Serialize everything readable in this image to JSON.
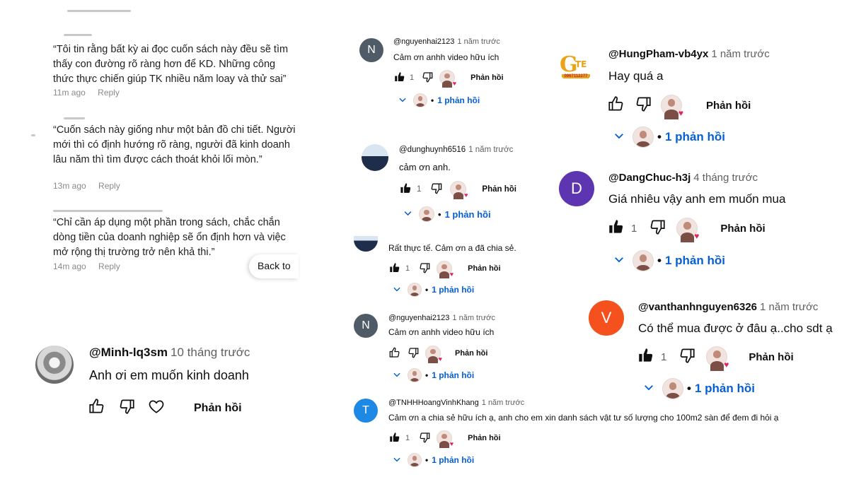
{
  "left_panel": {
    "top_fragment": "",
    "quotes": [
      {
        "text": "“Tôi tin rằng bất kỳ ai đọc cuốn sách này đều sẽ tìm thấy con đường rõ ràng hơn để KD. Những công thức thực chiến giúp TK nhiều năm loay và thử sai”",
        "time": "11m ago",
        "reply": "Reply"
      },
      {
        "text": "“Cuốn sách này giống như một bản đồ chi tiết. Người mới thì có định hướng rõ ràng, người đã kinh doanh lâu năm thì tìm được cách thoát khỏi lối mòn.”",
        "time": "13m ago",
        "reply": "Reply"
      },
      {
        "text": "“Chỉ cần áp dụng một phần trong sách, chắc chắn dòng tiền của doanh nghiệp sẽ ổn định hơn và việc mở rộng thị trường trở nên khả thi.”",
        "time": "14m ago",
        "reply": "Reply"
      }
    ],
    "back_to": "Back to"
  },
  "comments": {
    "minh": {
      "author": "@Minh-lq3sm",
      "time": "10 tháng trước",
      "text": "Anh ơi em muốn kinh doanh",
      "reply": "Phản hồi"
    },
    "nguyenhai_1": {
      "author": "@nguyenhai2123",
      "time": "1 năm trước",
      "text": "Cảm ơn anhh video hữu ích",
      "likes": "1",
      "reply": "Phản hồi",
      "replies": "1 phản hồi",
      "avatar_letter": "N"
    },
    "dunghuynh": {
      "author": "@dunghuynh6516",
      "time": "1 năm trước",
      "text": "cảm ơn anh.",
      "likes": "1",
      "reply": "Phản hồi",
      "replies": "1 phản hồi"
    },
    "thucte": {
      "text": "Rất thực tế. Cảm ơn a đã chia sẻ.",
      "likes": "1",
      "reply": "Phản hồi",
      "replies": "1 phản hồi"
    },
    "nguyenhai_2": {
      "author": "@nguyenhai2123",
      "time": "1 năm trước",
      "text": "Cảm ơn anhh video hữu ích",
      "reply": "Phản hồi",
      "replies": "1 phản hồi",
      "avatar_letter": "N"
    },
    "tnhh": {
      "author": "@TNHHHoangVinhKhang",
      "time": "1 năm trước",
      "text": "Cảm ơn a chia sẻ hữu ích ạ, anh cho em xin danh sách vật tư  số lượng cho 100m2 sàn để đem đi hỏi ạ",
      "likes": "1",
      "reply": "Phản hồi",
      "replies": "1 phản hồi",
      "avatar_letter": "T"
    },
    "hungpham": {
      "author": "@HungPham-vb4yx",
      "time": "1 năm trước",
      "text": "Hay quá a",
      "reply": "Phản hồi",
      "replies": "1 phản hồi",
      "logo_text": "0967112277"
    },
    "dangchuc": {
      "author": "@DangChuc-h3j",
      "time": "4 tháng trước",
      "text": "Giá nhiêu vậy anh em muốn mua",
      "likes": "1",
      "reply": "Phản hồi",
      "replies": "1 phản hồi",
      "avatar_letter": "D"
    },
    "vanthanh": {
      "author": "@vanthanhnguyen6326",
      "time": "1 năm trước",
      "text": "Có thể mua được ở đâu ạ..cho sdt ạ",
      "likes": "1",
      "reply": "Phản hồi",
      "replies": "1 phản hồi",
      "avatar_letter": "V"
    }
  },
  "colors": {
    "link_blue": "#065fd4",
    "avatar_n": "#4f5b66",
    "avatar_d": "#5e35b1",
    "avatar_v": "#f4511e",
    "avatar_t": "#1e88e5"
  }
}
